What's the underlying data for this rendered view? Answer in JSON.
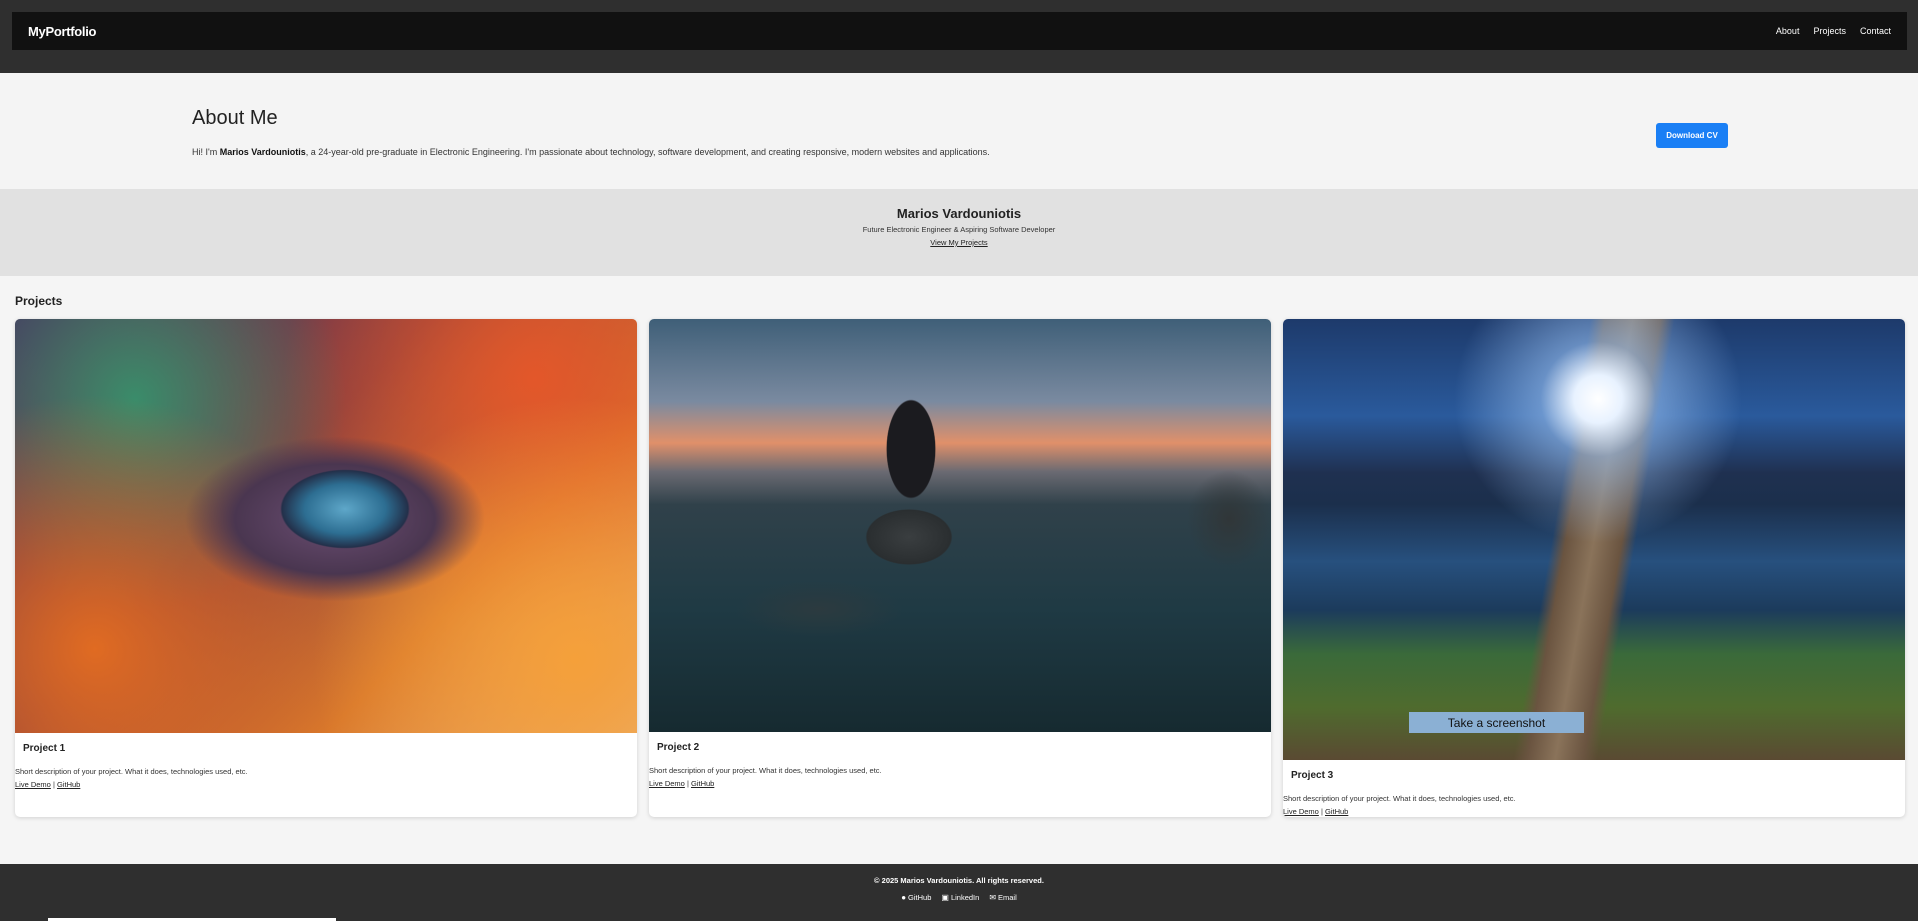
{
  "navbar": {
    "brand": "MyPortfolio",
    "links": [
      "About",
      "Projects",
      "Contact"
    ]
  },
  "about": {
    "title": "About Me",
    "intro_prefix": "Hi! I'm ",
    "intro_name": "Marios Vardouniotis",
    "intro_suffix": ", a 24-year-old pre-graduate in Electronic Engineering. I'm passionate about technology, software development, and creating responsive, modern websites and applications.",
    "download_label": "Download CV"
  },
  "hero": {
    "name": "Marios Vardouniotis",
    "subtitle": "Future Electronic Engineer & Aspiring Software Developer",
    "link": "View My Projects"
  },
  "projects": {
    "heading": "Projects",
    "items": [
      {
        "title": "Project 1",
        "description": "Short description of your project. What it does, technologies used, etc.",
        "demo": "Live Demo",
        "sep": " | ",
        "github": "GitHub"
      },
      {
        "title": "Project 2",
        "description": "Short description of your project. What it does, technologies used, etc.",
        "demo": "Live Demo",
        "sep": " | ",
        "github": "GitHub"
      },
      {
        "title": "Project 3",
        "description": "Short description of your project. What it does, technologies used, etc.",
        "demo": "Live Demo",
        "sep": " | ",
        "github": "GitHub"
      }
    ]
  },
  "overlay": {
    "screenshot_label": "Take a screenshot"
  },
  "footer": {
    "copyright": "© 2025 Marios Vardouniotis. All rights reserved.",
    "links": [
      {
        "icon": "github-icon",
        "label": "GitHub"
      },
      {
        "icon": "linkedin-icon",
        "label": "LinkedIn"
      },
      {
        "icon": "email-icon",
        "label": "Email"
      }
    ]
  },
  "colors": {
    "accent": "#1a7ff5",
    "nav_bg": "#111111",
    "footer_bg": "#2f2f2f"
  }
}
